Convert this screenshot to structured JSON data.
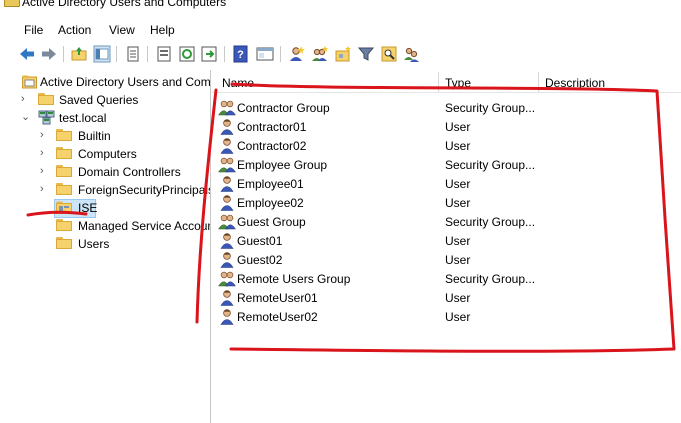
{
  "window": {
    "title": "Active Directory Users and Computers"
  },
  "menu": [
    "File",
    "Action",
    "View",
    "Help"
  ],
  "toolbar": {
    "icons": [
      "back-icon",
      "forward-icon",
      "up-folder-icon",
      "show-tree-icon",
      "properties-icon",
      "export-list-icon",
      "refresh-icon",
      "move-icon",
      "help-icon",
      "console-icon",
      "new-user-icon",
      "new-group-icon",
      "new-ou-icon",
      "filter-icon",
      "find-icon",
      "add-to-group-icon"
    ]
  },
  "tree": {
    "root": "Active Directory Users and Com",
    "saved_queries": "Saved Queries",
    "domain": "test.local",
    "children": [
      {
        "label": "Builtin",
        "expandable": true
      },
      {
        "label": "Computers",
        "expandable": true
      },
      {
        "label": "Domain Controllers",
        "expandable": true
      },
      {
        "label": "ForeignSecurityPrincipals",
        "expandable": true
      },
      {
        "label": "ISE",
        "expandable": false,
        "selected": true
      },
      {
        "label": "Managed Service Accoun",
        "expandable": false
      },
      {
        "label": "Users",
        "expandable": false
      }
    ]
  },
  "list": {
    "columns": [
      "Name",
      "Type",
      "Description"
    ],
    "rows": [
      {
        "name": "Contractor Group",
        "type": "Security Group...",
        "kind": "group"
      },
      {
        "name": "Contractor01",
        "type": "User",
        "kind": "user"
      },
      {
        "name": "Contractor02",
        "type": "User",
        "kind": "user"
      },
      {
        "name": "Employee Group",
        "type": "Security Group...",
        "kind": "group"
      },
      {
        "name": "Employee01",
        "type": "User",
        "kind": "user"
      },
      {
        "name": "Employee02",
        "type": "User",
        "kind": "user"
      },
      {
        "name": "Guest Group",
        "type": "Security Group...",
        "kind": "group"
      },
      {
        "name": "Guest01",
        "type": "User",
        "kind": "user"
      },
      {
        "name": "Guest02",
        "type": "User",
        "kind": "user"
      },
      {
        "name": "Remote Users Group",
        "type": "Security Group...",
        "kind": "group"
      },
      {
        "name": "RemoteUser01",
        "type": "User",
        "kind": "user"
      },
      {
        "name": "RemoteUser02",
        "type": "User",
        "kind": "user"
      }
    ]
  },
  "colors": {
    "annotation": "#d9141b",
    "selection": "#cce4f7",
    "folder": "#f5d26b"
  }
}
